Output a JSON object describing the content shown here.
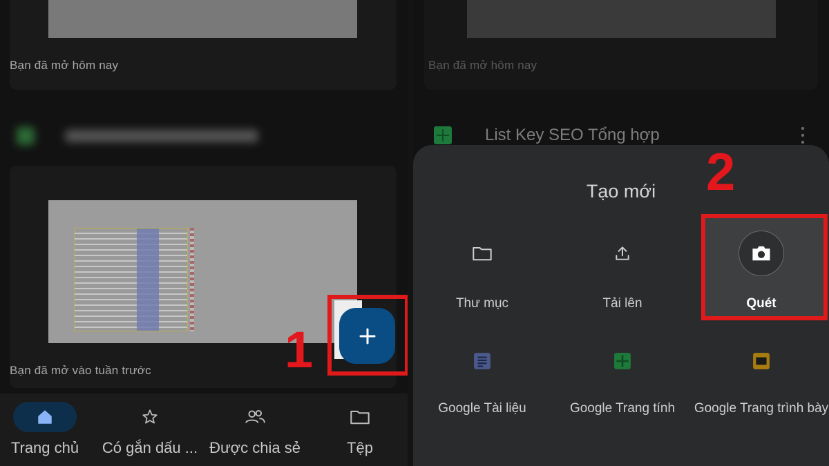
{
  "left_panel": {
    "caption_today": "Bạn đã mở hôm nay",
    "caption_last_week": "Bạn đã mở vào tuần trước"
  },
  "bottom_nav": {
    "items": [
      {
        "label": "Trang chủ",
        "icon": "home-icon",
        "active": true
      },
      {
        "label": "Có gắn dấu ...",
        "icon": "star-icon",
        "active": false
      },
      {
        "label": "Được chia sẻ",
        "icon": "people-icon",
        "active": false
      },
      {
        "label": "Tệp",
        "icon": "folder-icon",
        "active": false
      }
    ]
  },
  "fab": {
    "icon": "plus-icon",
    "color": "#0a4d85"
  },
  "annotations": {
    "step1": "1",
    "step2": "2",
    "highlight_color": "#e01a1a"
  },
  "right_panel": {
    "caption_today": "Bạn đã mở hôm nay",
    "file_title": "List Key SEO Tổng hợp"
  },
  "create_sheet": {
    "title": "Tạo mới",
    "options": [
      {
        "label": "Thư mục",
        "icon": "folder-icon"
      },
      {
        "label": "Tải lên",
        "icon": "upload-icon"
      },
      {
        "label": "Quét",
        "icon": "camera-icon",
        "highlighted": true
      },
      {
        "label": "Google Tài liệu",
        "icon": "docs-icon",
        "color": "#4a5a8c"
      },
      {
        "label": "Google Trang tính",
        "icon": "sheets-icon",
        "color": "#1e7a3a"
      },
      {
        "label": "Google Trang trình bày",
        "icon": "slides-icon",
        "color": "#a87d10"
      }
    ]
  }
}
